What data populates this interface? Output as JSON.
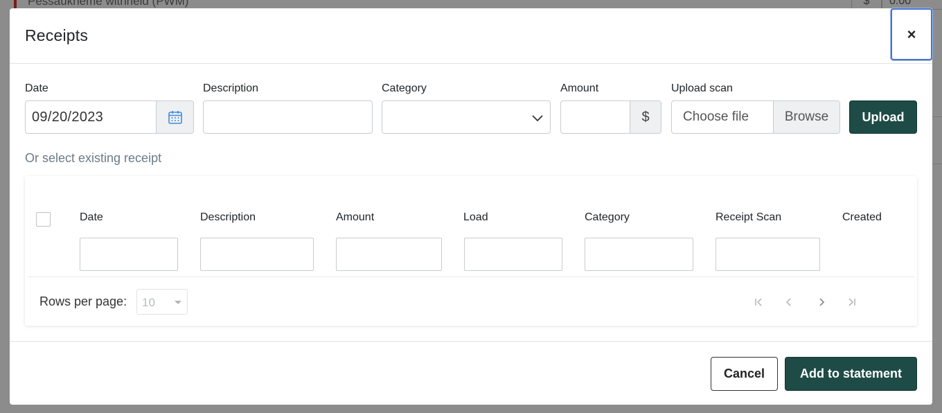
{
  "backdrop": {
    "partial_text": "Pessaukneme withheld (PWM)",
    "cell1": "$",
    "cell2": "0.00"
  },
  "modal": {
    "title": "Receipts",
    "close_label": "×"
  },
  "form": {
    "date_label": "Date",
    "date_value": "09/20/2023",
    "description_label": "Description",
    "category_label": "Category",
    "amount_label": "Amount",
    "amount_addon": "$",
    "upload_label": "Upload scan",
    "file_placeholder": "Choose file",
    "browse_label": "Browse",
    "upload_button": "Upload"
  },
  "existing": {
    "heading": "Or select existing receipt"
  },
  "table": {
    "columns": [
      "Date",
      "Description",
      "Amount",
      "Load",
      "Category",
      "Receipt Scan",
      "Created"
    ],
    "rows_per_page_label": "Rows per page:",
    "rows_per_page_value": "10"
  },
  "footer": {
    "cancel_label": "Cancel",
    "add_label": "Add to statement"
  },
  "colors": {
    "primary": "#1e4b46",
    "focus_ring": "#4a74c9",
    "muted_text": "#6b7b87"
  },
  "icons": {
    "calendar": "calendar-icon",
    "chevron": "chevron-down-icon",
    "close": "close-icon"
  }
}
